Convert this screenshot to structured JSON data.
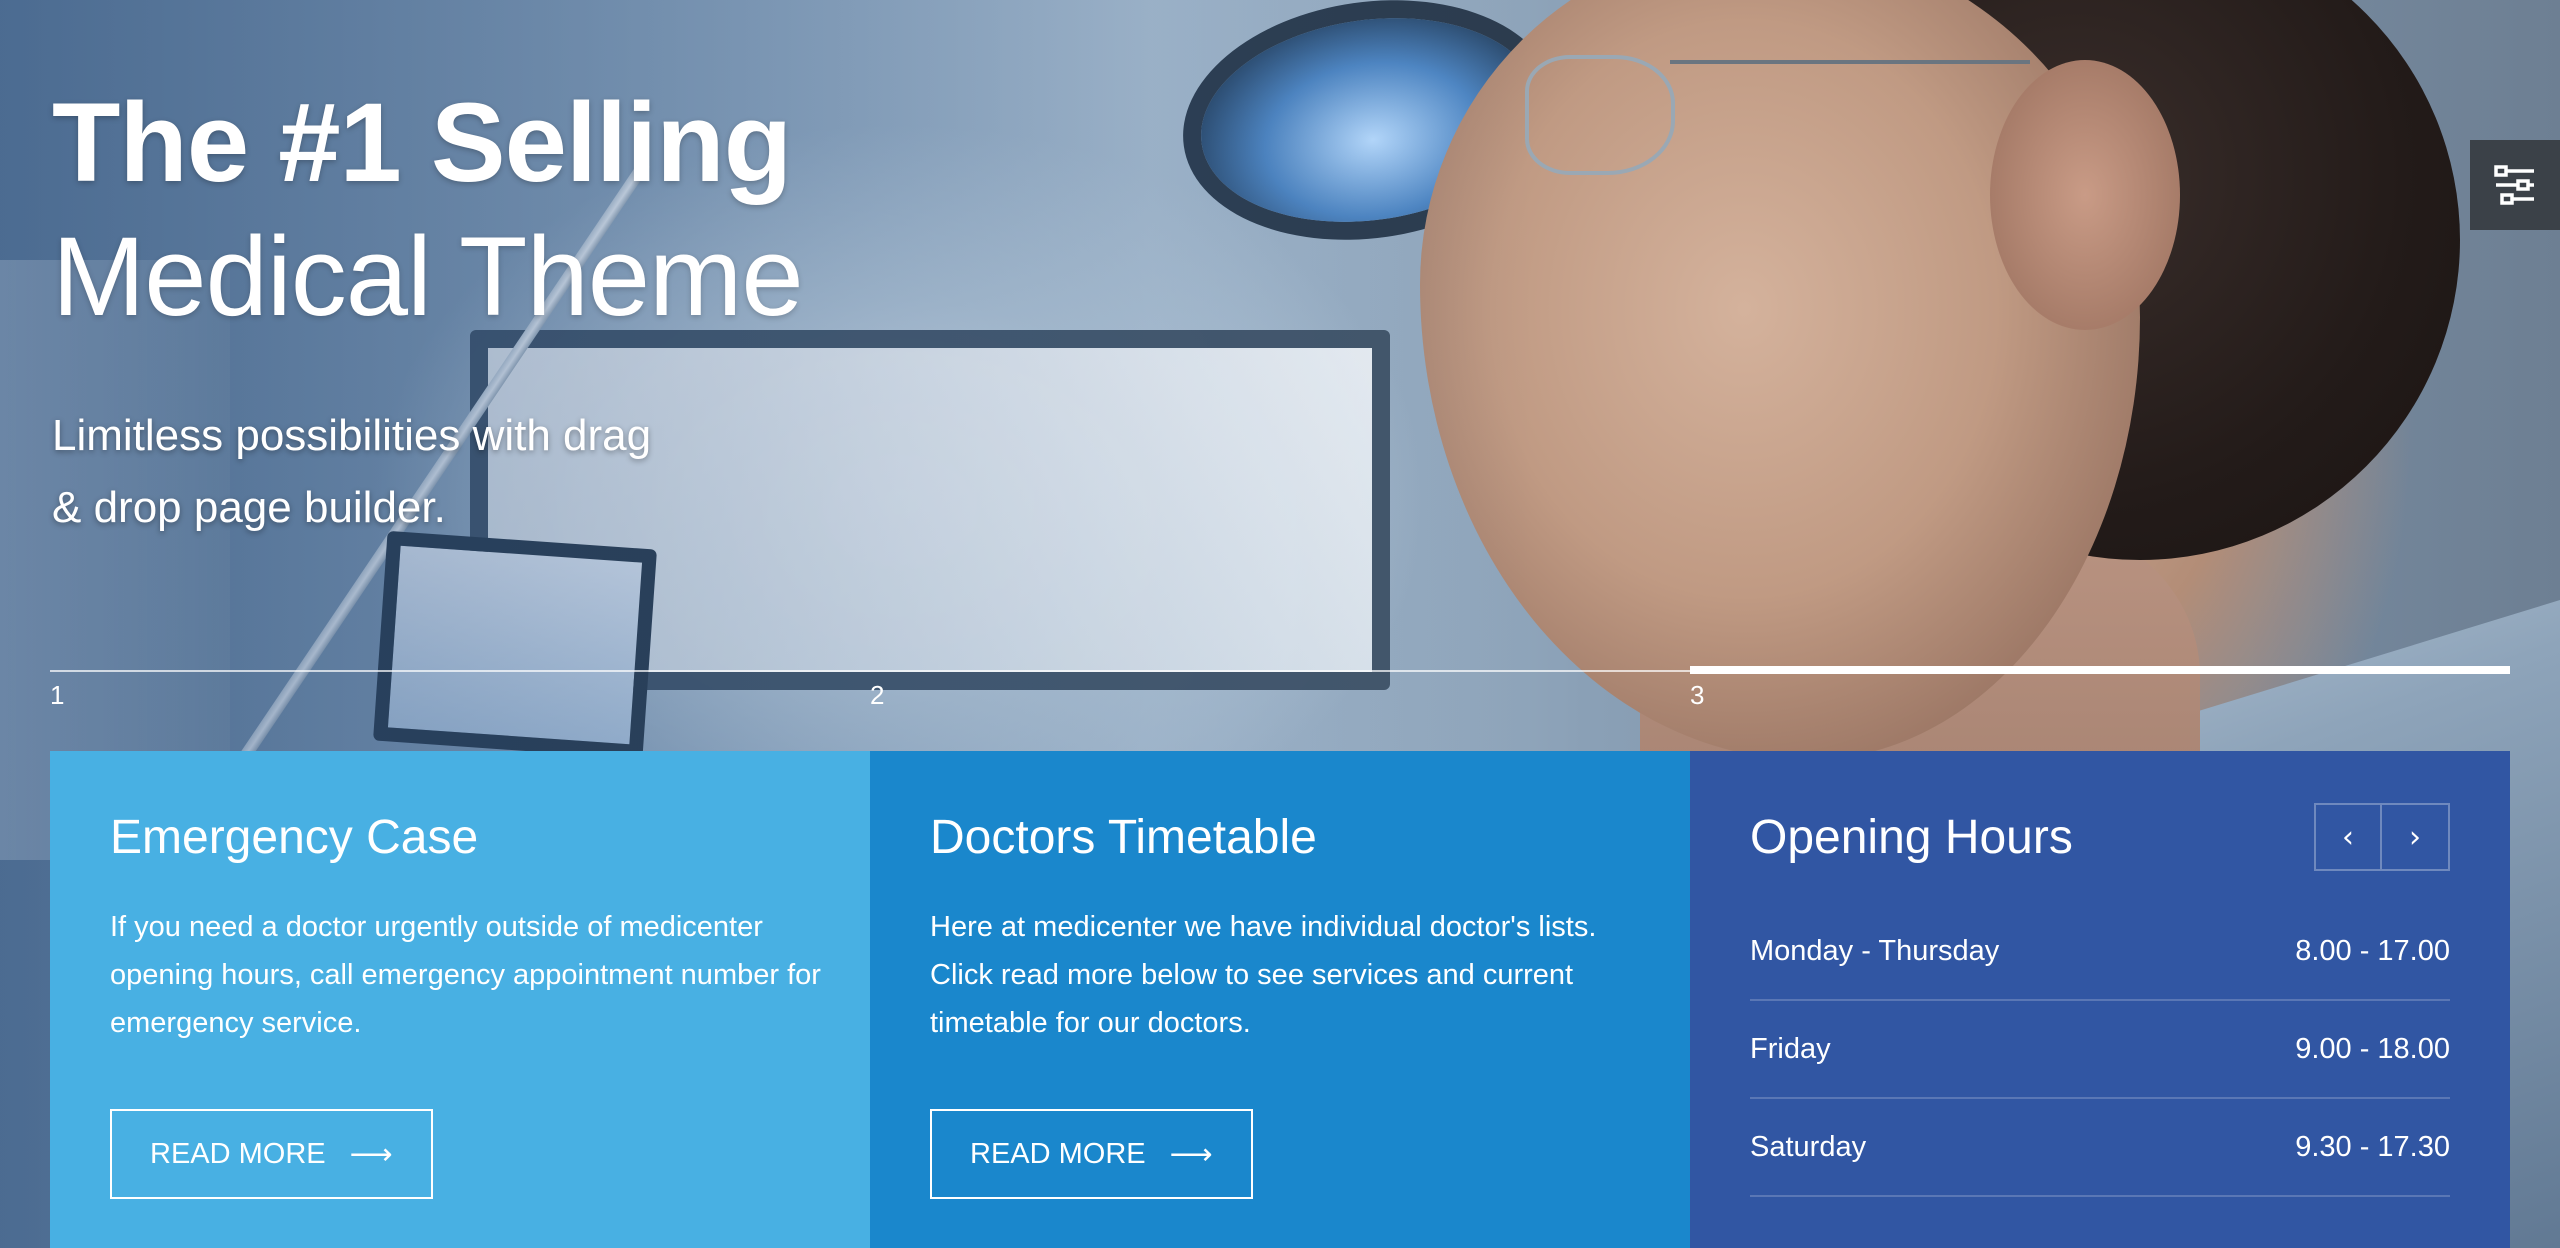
{
  "hero": {
    "title": "The #1 Selling",
    "subtitle": "Medical Theme",
    "description": "Limitless possibilities with drag & drop page builder."
  },
  "pager": {
    "items": [
      {
        "label": "1"
      },
      {
        "label": "2"
      },
      {
        "label": "3"
      }
    ],
    "active_index": 2
  },
  "settings": {
    "icon": "settings-sliders-icon"
  },
  "boxes": {
    "emergency": {
      "title": "Emergency Case",
      "text": "If you need a doctor urgently outside of medicenter opening hours, call emergency appointment number for emergency service.",
      "button_label": "READ MORE",
      "button_icon": "arrow-right-icon",
      "color": "#48b0e3"
    },
    "timetable": {
      "title": "Doctors Timetable",
      "text": "Here at medicenter we have individual doctor's lists. Click read more below to see services and current timetable for our doctors.",
      "button_label": "READ MORE",
      "button_icon": "arrow-right-icon",
      "color": "#1a87cc"
    },
    "hours": {
      "title": "Opening Hours",
      "prev_icon": "chevron-left-icon",
      "next_icon": "chevron-right-icon",
      "color": "#3156a3",
      "rows": [
        {
          "day": "Monday - Thursday",
          "time": "8.00 - 17.00"
        },
        {
          "day": "Friday",
          "time": "9.00 - 18.00"
        },
        {
          "day": "Saturday",
          "time": "9.30 - 17.30"
        }
      ]
    }
  }
}
